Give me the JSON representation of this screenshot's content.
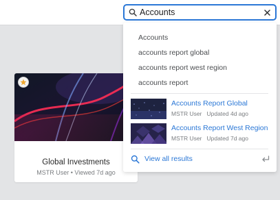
{
  "search": {
    "value": "Accounts",
    "placeholder": ""
  },
  "suggestions": [
    "Accounts",
    "accounts report global",
    "accounts report west region",
    "accounts report"
  ],
  "results": [
    {
      "title": "Accounts Report Global",
      "owner": "MSTR User",
      "updated": "Updated 4d ago"
    },
    {
      "title": "Accounts Report West Region",
      "owner": "MSTR User",
      "updated": "Updated 7d ago"
    }
  ],
  "view_all_label": "View all results",
  "card": {
    "title": "Global Investments",
    "owner": "MSTR User",
    "separator": "•",
    "viewed": "Viewed 7d ago"
  },
  "icons": {
    "search": "search-icon",
    "clear": "close-icon",
    "favorite": "star-icon",
    "enter": "enter-return-icon"
  },
  "colors": {
    "accent": "#2a77d6",
    "background": "#e3e4e6",
    "star": "#f0a830"
  }
}
